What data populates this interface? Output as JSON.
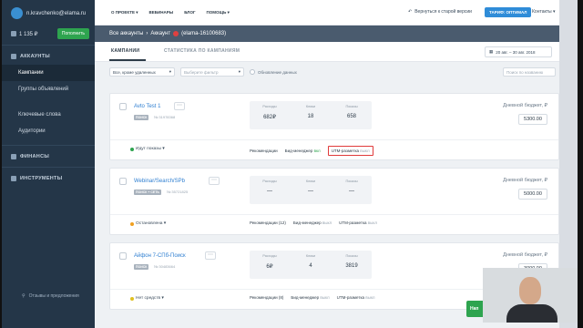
{
  "sidebar": {
    "email": "n.kravchenko@elama.ru",
    "balance": "1 135 ₽",
    "topup_label": "Пополнить",
    "accounts_section": "АККАУНТЫ",
    "items": [
      "Кампании",
      "Группы объявлений",
      "Ключевые слова",
      "Аудитории"
    ],
    "finance_section": "ФИНАНСЫ",
    "tools_section": "ИНСТРУМЕНТЫ",
    "feedback": "Отзывы и предложения"
  },
  "topnav": {
    "menu": [
      "О ПРОЕКТЕ ▾",
      "ВЕБИНАРЫ",
      "БЛОГ",
      "ПОМОЩЬ ▾"
    ],
    "old_version": "Вернуться к старой версии",
    "tariff": "ТАРИФ: ОПТИМАЛ",
    "contacts": "Контакты ▾"
  },
  "breadcrumb": {
    "all": "Все аккаунты",
    "sep": "›",
    "account": "Аккаунт",
    "account_name": "(elama-16100683)"
  },
  "tabs": {
    "campaigns": "КАМПАНИИ",
    "stats": "СТАТИСТИКА ПО КАМПАНИЯМ",
    "date_range": "20 авг. – 30 авг. 2018"
  },
  "filters": {
    "status": "Все, кроме удаленных",
    "filter_placeholder": "Выберите фильтр",
    "updated": "Обновление данных",
    "search_placeholder": "Поиск по названию"
  },
  "metric_labels": {
    "spend": "Расходы",
    "clicks": "Клики",
    "impressions": "Показы"
  },
  "budget_label": "Дневной бюджет, ₽",
  "campaigns": [
    {
      "name": "Avto Test 1",
      "tag": "ПОИСК",
      "id": "№ 31978368",
      "spend": "682₽",
      "clicks": "18",
      "impressions": "658",
      "budget": "5300.00",
      "status": "Идут показы ▾",
      "status_color": "#2ea44f",
      "recommendations": "Рекомендации",
      "bid_manager": "Бид-менеджер",
      "bid_state": "вкл",
      "utm": "UTM-разметка",
      "utm_state": "выкл"
    },
    {
      "name": "Webinar/Search/SPb",
      "tag": "ПОИСК + СЕТЬ",
      "id": "№ 35721825",
      "spend": "—",
      "clicks": "—",
      "impressions": "—",
      "budget": "5000.00",
      "status": "Остановлена ▾",
      "status_color": "#f0a020",
      "recommendations": "Рекомендации (12)",
      "bid_manager": "Бид-менеджер",
      "bid_state": "выкл",
      "utm": "UTM-разметка",
      "utm_state": "выкл"
    },
    {
      "name": "Айфон 7-СПб-Поиск",
      "tag": "ПОИСК",
      "id": "№ 30483664",
      "spend": "6₽",
      "clicks": "4",
      "impressions": "3819",
      "budget": "3000.00",
      "status": "Нет средств ▾",
      "status_color": "#e0c020",
      "recommendations": "Рекомендации (8)",
      "bid_manager": "Бид-менеджер",
      "bid_state": "выкл",
      "utm": "UTM-разметка",
      "utm_state": "выкл"
    }
  ],
  "green_button": "Нап"
}
